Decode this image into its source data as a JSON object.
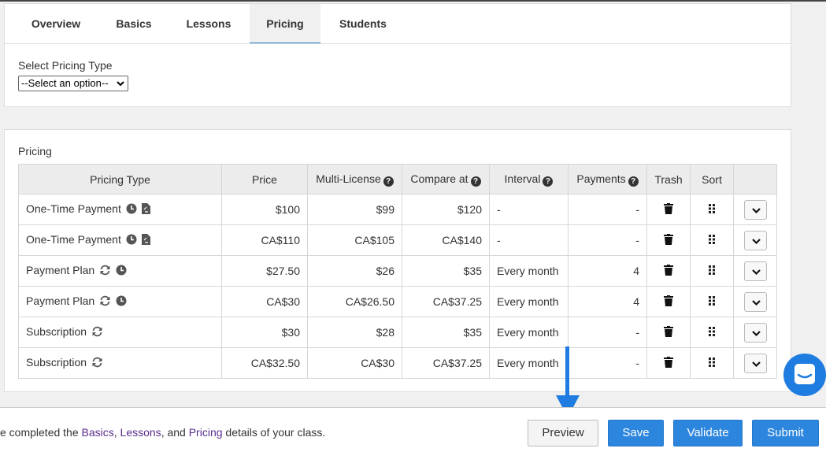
{
  "tabs": [
    {
      "label": "Overview"
    },
    {
      "label": "Basics"
    },
    {
      "label": "Lessons"
    },
    {
      "label": "Pricing",
      "active": true
    },
    {
      "label": "Students"
    }
  ],
  "select_section": {
    "label": "Select Pricing Type",
    "value": "--Select an option--"
  },
  "pricing": {
    "title": "Pricing",
    "headers": {
      "type": "Pricing Type",
      "price": "Price",
      "multi": "Multi-License",
      "compare": "Compare at",
      "interval": "Interval",
      "payments": "Payments",
      "trash": "Trash",
      "sort": "Sort"
    },
    "rows": [
      {
        "type": "One-Time Payment",
        "icons": [
          "clock-icon",
          "document-icon"
        ],
        "price": "$100",
        "multi": "$99",
        "compare": "$120",
        "interval": "-",
        "payments": "-"
      },
      {
        "type": "One-Time Payment",
        "icons": [
          "clock-icon",
          "document-icon"
        ],
        "price": "CA$110",
        "multi": "CA$105",
        "compare": "CA$140",
        "interval": "-",
        "payments": "-"
      },
      {
        "type": "Payment Plan",
        "icons": [
          "refresh-icon",
          "clock-icon"
        ],
        "price": "$27.50",
        "multi": "$26",
        "compare": "$35",
        "interval": "Every month",
        "payments": "4"
      },
      {
        "type": "Payment Plan",
        "icons": [
          "refresh-icon",
          "clock-icon"
        ],
        "price": "CA$30",
        "multi": "CA$26.50",
        "compare": "CA$37.25",
        "interval": "Every month",
        "payments": "4"
      },
      {
        "type": "Subscription",
        "icons": [
          "refresh-icon"
        ],
        "price": "$30",
        "multi": "$28",
        "compare": "$35",
        "interval": "Every month",
        "payments": "-"
      },
      {
        "type": "Subscription",
        "icons": [
          "refresh-icon"
        ],
        "price": "CA$32.50",
        "multi": "CA$30",
        "compare": "CA$37.25",
        "interval": "Every month",
        "payments": "-"
      }
    ]
  },
  "bottom": {
    "text_prefix": "e completed the ",
    "link_basics": "Basics",
    "sep1": ", ",
    "link_lessons": "Lessons",
    "sep2": ", and ",
    "link_pricing": "Pricing",
    "text_suffix": " details of your class.",
    "preview": "Preview",
    "save": "Save",
    "validate": "Validate",
    "submit": "Submit"
  },
  "colors": {
    "accent": "#2d86de",
    "link": "#5b2d8e",
    "arrow": "#1f7ce0"
  }
}
